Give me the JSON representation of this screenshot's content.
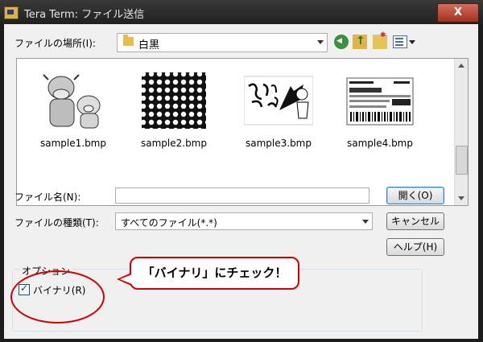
{
  "window": {
    "title": "Tera Term: ファイル送信",
    "close_label": "X"
  },
  "location": {
    "label": "ファイルの場所(I):",
    "folder": "白黒"
  },
  "toolbar": {
    "icons": [
      "back-icon",
      "up-folder-icon",
      "new-folder-icon",
      "view-menu-icon"
    ]
  },
  "files": [
    {
      "name": "sample1.bmp"
    },
    {
      "name": "sample2.bmp"
    },
    {
      "name": "sample3.bmp"
    },
    {
      "name": "sample4.bmp"
    }
  ],
  "filename": {
    "label": "ファイル名(N):",
    "value": ""
  },
  "filetype": {
    "label": "ファイルの種類(T):",
    "value": "すべてのファイル(*.*)"
  },
  "buttons": {
    "open": "開く(O)",
    "cancel": "キャンセル",
    "help": "ヘルプ(H)"
  },
  "options": {
    "label": "オプション",
    "binary_label": "バイナリ(R)",
    "binary_checked": true
  },
  "annotation": {
    "text": "「バイナリ」にチェック！",
    "color": "#d40000"
  }
}
